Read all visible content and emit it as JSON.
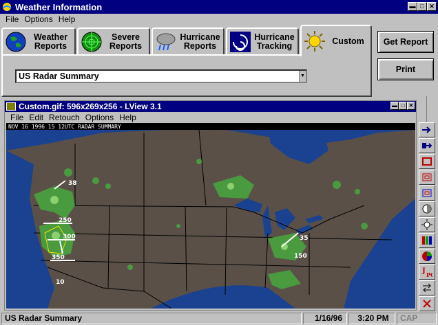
{
  "app": {
    "title": "Weather Information"
  },
  "menu": [
    "File",
    "Options",
    "Help"
  ],
  "tabs": [
    {
      "label": "Weather\nReports",
      "icon": "globe-icon"
    },
    {
      "label": "Severe\nReports",
      "icon": "radar-icon"
    },
    {
      "label": "Hurricane\nReports",
      "icon": "storm-cloud-icon"
    },
    {
      "label": "Hurricane\nTracking",
      "icon": "hurricane-swirl-icon"
    },
    {
      "label": "Custom",
      "icon": "sun-icon",
      "active": true
    }
  ],
  "report_select": {
    "value": "US Radar Summary"
  },
  "buttons": {
    "get_report": "Get Report",
    "print": "Print"
  },
  "viewer": {
    "title": "Custom.gif: 596x269x256 - LView 3.1",
    "menu": [
      "File",
      "Edit",
      "Retouch",
      "Options",
      "Help"
    ]
  },
  "map": {
    "header_text": "NOV 16 1996 15 12UTC RADAR SUMMARY",
    "labels": [
      "38",
      "250",
      "300",
      "350",
      "10",
      "35",
      "150"
    ]
  },
  "toolbar_icons": [
    "arrow-right-icon",
    "arrow-right-save-icon",
    "crop-icon",
    "frame-icon",
    "nested-frame-icon",
    "contrast-icon",
    "brightness-icon",
    "rgb-bars-icon",
    "color-wheel-icon",
    "jpeg-icon",
    "swap-icon",
    "close-x-icon"
  ],
  "status": {
    "text": "US Radar Summary",
    "date": "1/16/96",
    "time": "3:20 PM",
    "caps": "CAP"
  }
}
